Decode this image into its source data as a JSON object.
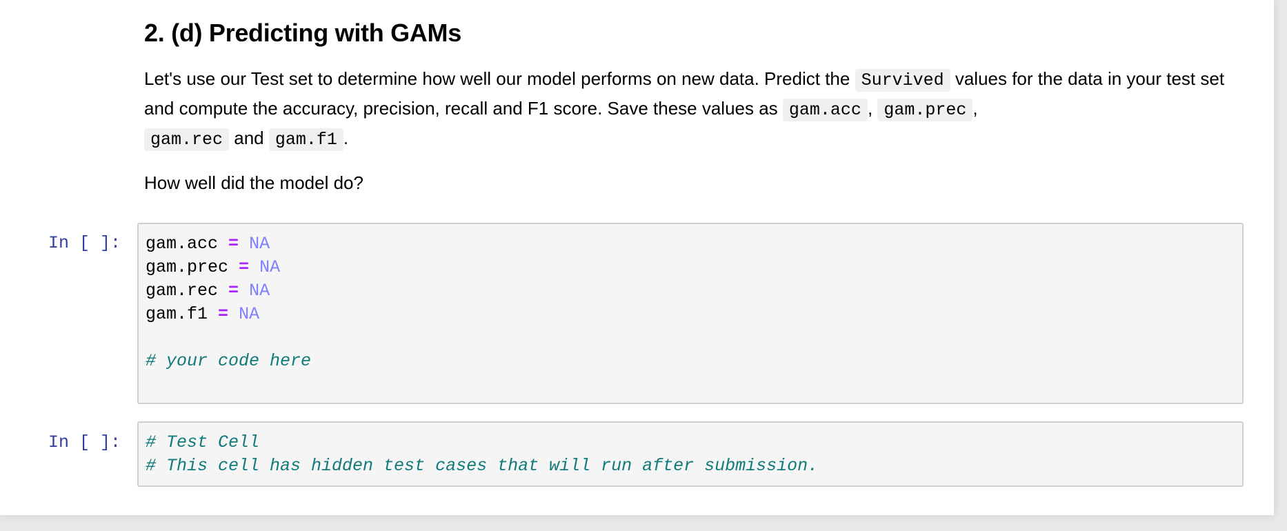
{
  "markdown": {
    "title": "2. (d) Predicting with GAMs",
    "intro": {
      "part1": "Let's use our Test set to determine how well our model performs on new data. Predict the ",
      "code_survived": "Survived",
      "part2": " values for the data in your test set and compute the accuracy, precision, recall and F1 score. Save these values as ",
      "code_acc": "gam.acc",
      "sep1": ", ",
      "code_prec": "gam.prec",
      "sep2": ", ",
      "code_rec": "gam.rec",
      "sep3": " and ",
      "code_f1": "gam.f1",
      "end": "."
    },
    "question": "How well did the model do?"
  },
  "cells": [
    {
      "prompt": "In [ ]:",
      "lines": [
        {
          "var": "gam.acc",
          "op": "=",
          "val": "NA"
        },
        {
          "var": "gam.prec",
          "op": "=",
          "val": "NA"
        },
        {
          "var": "gam.rec",
          "op": "=",
          "val": "NA"
        },
        {
          "var": "gam.f1",
          "op": "=",
          "val": "NA"
        }
      ],
      "comment": "# your code here"
    },
    {
      "prompt": "In [ ]:",
      "comments": [
        "# Test Cell",
        "# This cell has hidden test cases that will run after submission."
      ]
    }
  ],
  "colors": {
    "prompt": "#303f9f",
    "operator": "#aa22ff",
    "constant": "#7f7fff",
    "comment": "#117a7a",
    "cell_background": "#f5f5f5",
    "cell_border": "#cfcfcf"
  }
}
